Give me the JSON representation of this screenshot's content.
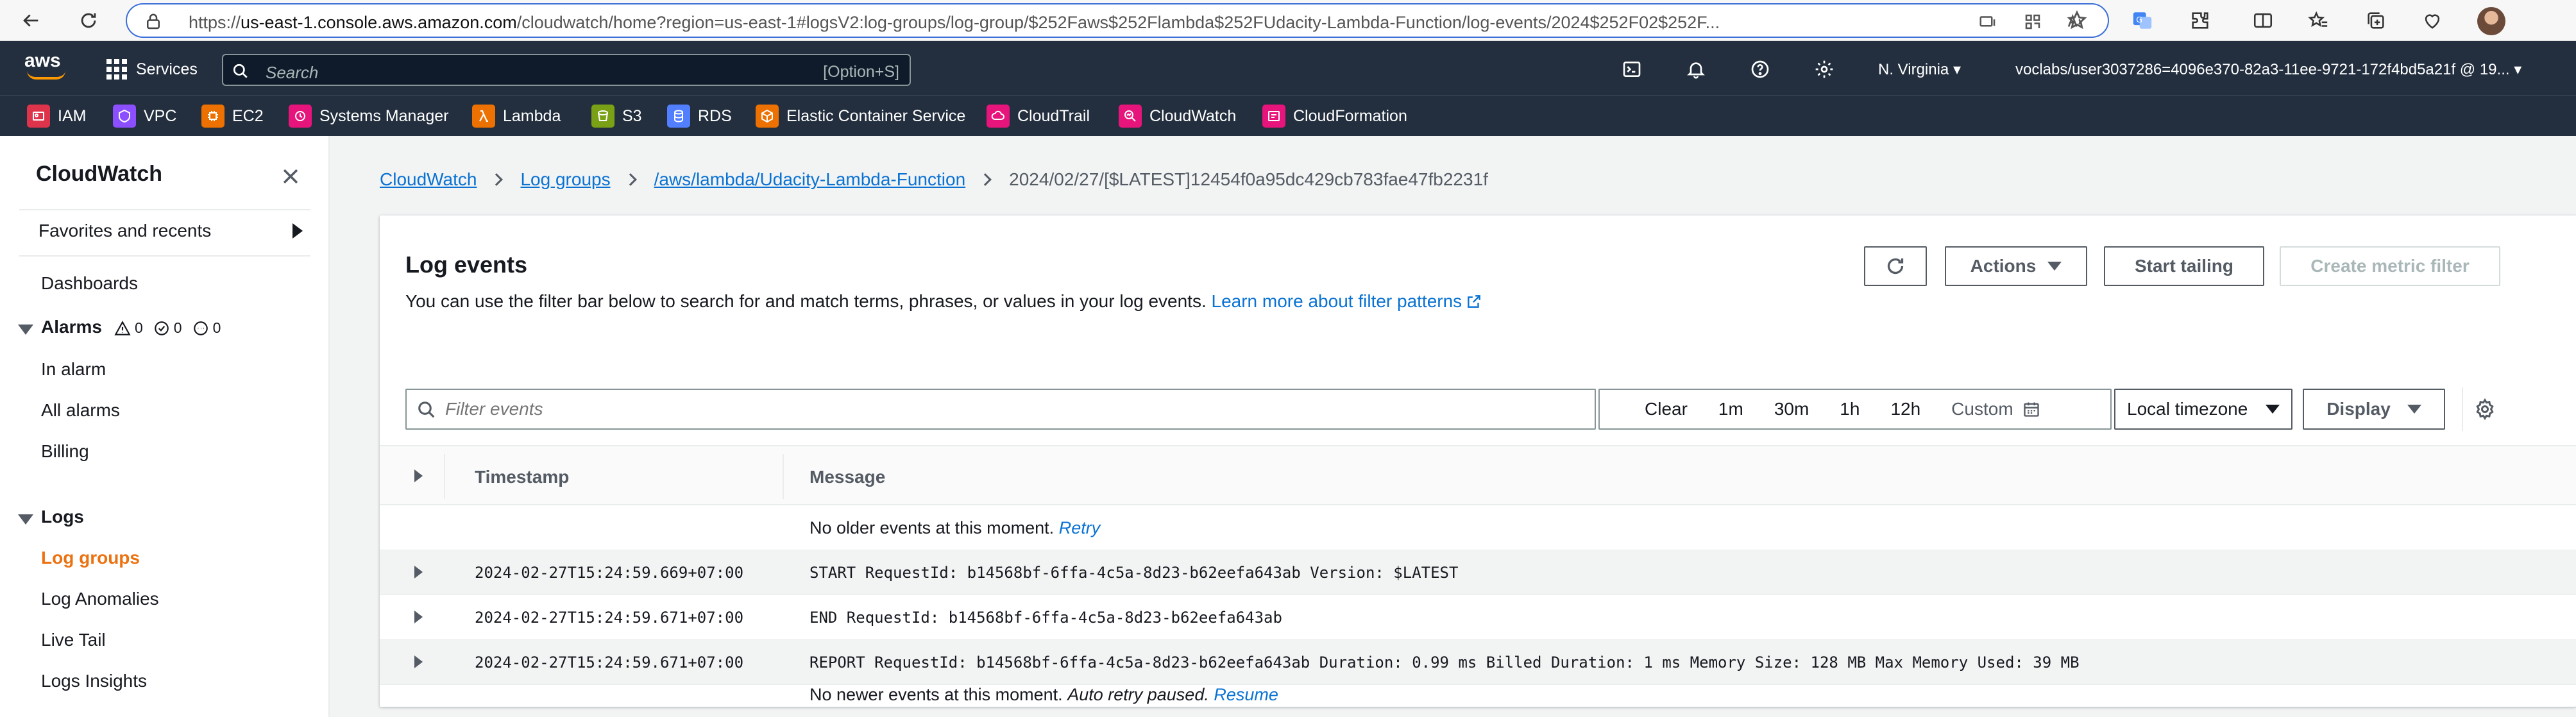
{
  "browser": {
    "url_prefix": "https://",
    "url_host": "us-east-1.console.aws.amazon.com",
    "url_path": "/cloudwatch/home?region=us-east-1#logsV2:log-groups/log-group/$252Faws$252Flambda$252FUdacity-Lambda-Function/log-events/2024$252F02$252F..."
  },
  "aws_nav": {
    "logo": "aws",
    "services_label": "Services",
    "search_placeholder": "Search",
    "search_shortcut": "[Option+S]",
    "region": "N. Virginia",
    "account": "voclabs/user3037286=4096e370-82a3-11ee-9721-172f4bd5a21f @ 19..."
  },
  "favorites": [
    {
      "label": "IAM",
      "color": "#dd344c"
    },
    {
      "label": "VPC",
      "color": "#8c4fff"
    },
    {
      "label": "EC2",
      "color": "#ed7100"
    },
    {
      "label": "Systems Manager",
      "color": "#e7157b"
    },
    {
      "label": "Lambda",
      "color": "#ed7100"
    },
    {
      "label": "S3",
      "color": "#7aa116"
    },
    {
      "label": "RDS",
      "color": "#527fff"
    },
    {
      "label": "Elastic Container Service",
      "color": "#ed7100"
    },
    {
      "label": "CloudTrail",
      "color": "#e7157b"
    },
    {
      "label": "CloudWatch",
      "color": "#e7157b"
    },
    {
      "label": "CloudFormation",
      "color": "#e7157b"
    }
  ],
  "sidebar": {
    "title": "CloudWatch",
    "favorites_label": "Favorites and recents",
    "dashboards": "Dashboards",
    "alarms_label": "Alarms",
    "alarm_counts": [
      "0",
      "0",
      "0"
    ],
    "alarm_items": [
      "In alarm",
      "All alarms",
      "Billing"
    ],
    "logs_label": "Logs",
    "log_items": [
      "Log groups",
      "Log Anomalies",
      "Live Tail",
      "Logs Insights"
    ]
  },
  "breadcrumbs": [
    "CloudWatch",
    "Log groups",
    "/aws/lambda/Udacity-Lambda-Function",
    "2024/02/27/[$LATEST]12454f0a95dc429cb783fae47fb2231f"
  ],
  "panel": {
    "title": "Log events",
    "description": "You can use the filter bar below to search for and match terms, phrases, or values in your log events.",
    "learn_more": "Learn more about filter patterns",
    "actions_label": "Actions",
    "start_tailing_label": "Start tailing",
    "create_metric_filter_label": "Create metric filter",
    "filter_placeholder": "Filter events",
    "time_options": [
      "Clear",
      "1m",
      "30m",
      "1h",
      "12h"
    ],
    "custom_label": "Custom",
    "timezone": "Local timezone",
    "display_label": "Display"
  },
  "table": {
    "columns": [
      "Timestamp",
      "Message"
    ],
    "no_older": "No older events at this moment.",
    "retry": "Retry",
    "rows": [
      {
        "timestamp": "2024-02-27T15:24:59.669+07:00",
        "message": "START RequestId: b14568bf-6ffa-4c5a-8d23-b62eefa643ab Version: $LATEST"
      },
      {
        "timestamp": "2024-02-27T15:24:59.671+07:00",
        "message": "END RequestId: b14568bf-6ffa-4c5a-8d23-b62eefa643ab"
      },
      {
        "timestamp": "2024-02-27T15:24:59.671+07:00",
        "message": "REPORT RequestId: b14568bf-6ffa-4c5a-8d23-b62eefa643ab Duration: 0.99 ms Billed Duration: 1 ms Memory Size: 128 MB Max Memory Used: 39 MB"
      }
    ],
    "no_newer": "No newer events at this moment.",
    "auto_retry": "Auto retry paused.",
    "resume": "Resume"
  },
  "colors": {
    "aws_nav_bg": "#232f3e",
    "link": "#0972d3",
    "active_nav": "#ec7211"
  }
}
